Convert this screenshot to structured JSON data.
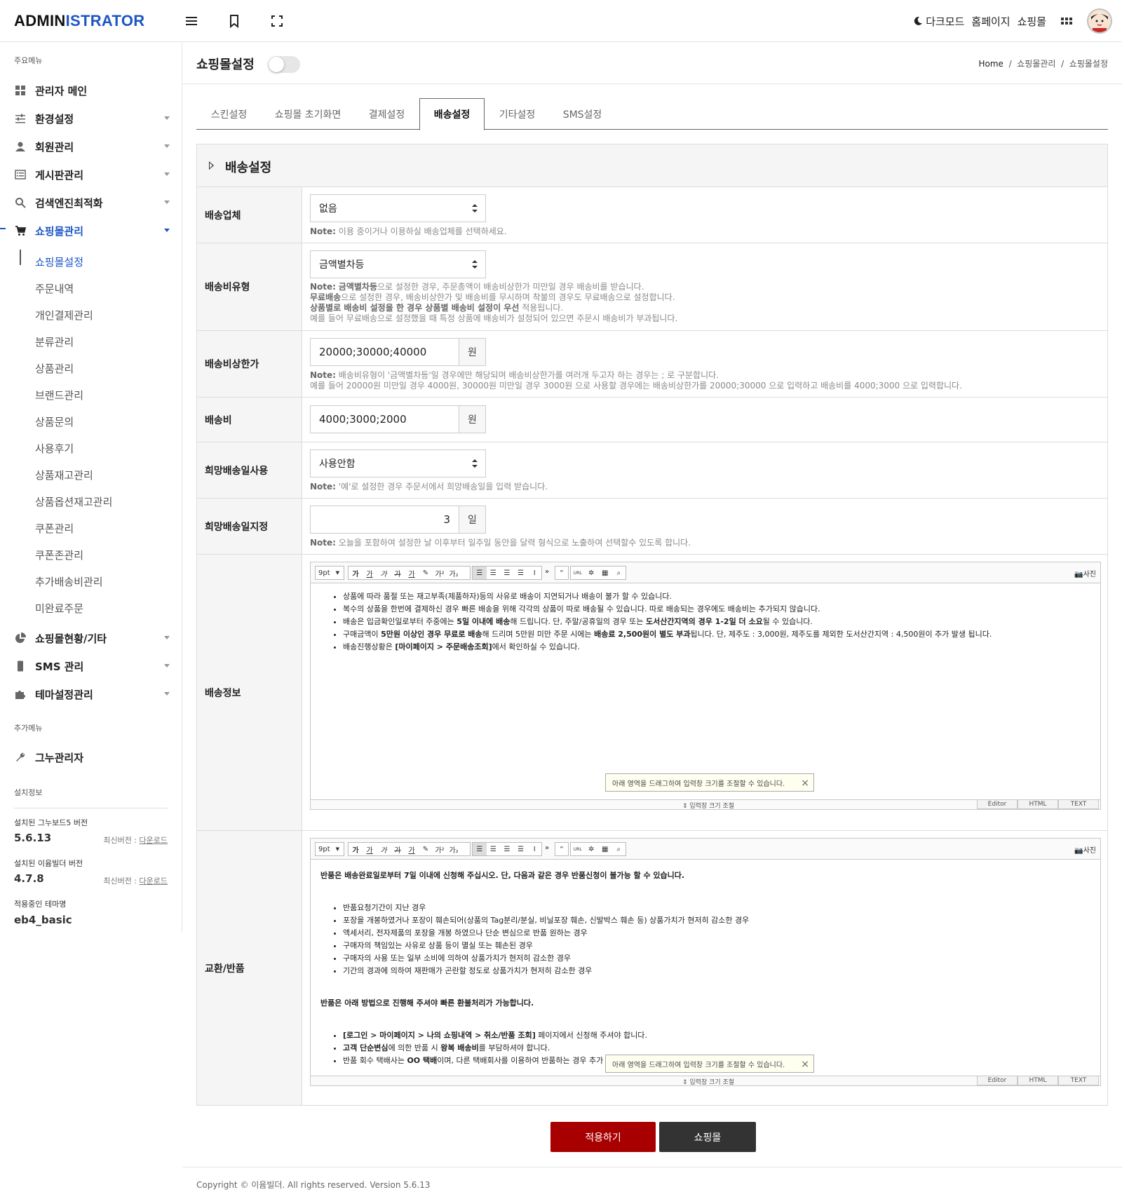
{
  "header": {
    "logo_a": "ADMIN",
    "logo_b": "ISTRATOR",
    "darkmode": "다크모드",
    "homepage": "홈페이지",
    "shop": "쇼핑몰"
  },
  "sidebar": {
    "main_label": "주요메뉴",
    "items": [
      {
        "label": "관리자 메인"
      },
      {
        "label": "환경설정"
      },
      {
        "label": "회원관리"
      },
      {
        "label": "게시판관리"
      },
      {
        "label": "검색엔진최적화"
      },
      {
        "label": "쇼핑몰관리"
      },
      {
        "label": "쇼핑몰현황/기타"
      },
      {
        "label": "SMS 관리"
      },
      {
        "label": "테마설정관리"
      }
    ],
    "submenu": [
      "쇼핑몰설정",
      "주문내역",
      "개인결제관리",
      "분류관리",
      "상품관리",
      "브랜드관리",
      "상품문의",
      "사용후기",
      "상품재고관리",
      "상품옵션재고관리",
      "쿠폰관리",
      "쿠폰존관리",
      "추가배송비관리",
      "미완료주문"
    ],
    "extra_label": "추가메뉴",
    "extra_item": "그누관리자",
    "install_label": "설치정보",
    "gnuboard_title": "설치된 그누보드5 버전",
    "gnuboard_version": "5.6.13",
    "eyoom_title": "설치된 이윰빌더 버전",
    "eyoom_version": "4.7.8",
    "latest_label": "최신버전 : ",
    "download": "다운로드",
    "theme_title": "적용중인 테마명",
    "theme_name": "eb4_basic"
  },
  "page": {
    "title": "쇼핑몰설정",
    "breadcrumb": [
      "Home",
      "쇼핑몰관리",
      "쇼핑몰설정"
    ],
    "sep": "/"
  },
  "tabs": [
    "스킨설정",
    "쇼핑몰 초기화면",
    "결제설정",
    "배송설정",
    "기타설정",
    "SMS설정"
  ],
  "section": {
    "title": "배송설정",
    "note_prefix": "Note:",
    "rows": {
      "company": {
        "label": "배송업체",
        "value": "없음",
        "note": " 이용 중이거나 이용하실 배송업체를 선택하세요."
      },
      "fee_type": {
        "label": "배송비유형",
        "value": "금액별차등",
        "n1_b": "금액별차등",
        "n1": "으로 설정한 경우, 주문총액이 배송비상한가 미만일 경우 배송비를 받습니다.",
        "n2_b": "무료배송",
        "n2": "으로 설정한 경우, 배송비상한가 및 배송비를 무시하며 착불의 경우도 무료배송으로 설정합니다.",
        "n3_b": "상품별로 배송비 설정을 한 경우 상품별 배송비 설정이 우선",
        "n3": " 적용됩니다.",
        "n4": "예를 들어 무료배송으로 설정했을 때 특정 상품에 배송비가 설정되어 있으면 주문시 배송비가 부과됩니다."
      },
      "fee_limit": {
        "label": "배송비상한가",
        "value": "20000;30000;40000",
        "unit": "원",
        "n1": " 배송비유형이 '금액별차등'일 경우에만 해당되며 배송비상한가를 여러개 두고자 하는 경우는 ; 로 구분합니다.",
        "n2": "예를 들어 20000원 미만일 경우 4000원, 30000원 미만일 경우 3000원 으로 사용할 경우에는 배송비상한가를 20000;30000 으로 입력하고 배송비를 4000;3000 으로 입력합니다."
      },
      "fee": {
        "label": "배송비",
        "value": "4000;3000;2000",
        "unit": "원"
      },
      "hope_use": {
        "label": "희망배송일사용",
        "value": "사용안함",
        "note": " '예'로 설정한 경우 주문서에서 희망배송일을 입력 받습니다."
      },
      "hope_days": {
        "label": "희망배송일지정",
        "value": "3",
        "unit": "일",
        "note": " 오늘을 포함하여 설정한 날 이후부터 일주일 동안을 달력 형식으로 노출하여 선택할수 있도록 합니다."
      },
      "delivery_info": {
        "label": "배송정보"
      },
      "exchange": {
        "label": "교환/반품"
      }
    }
  },
  "editor": {
    "font_size": "9pt",
    "photo": "사진",
    "resize": "입력창 크기 조절",
    "tip": "아래 영역을 드래그하여 입력창 크기를 조절할 수 있습니다.",
    "close": "×",
    "modes": [
      "Editor",
      "HTML",
      "TEXT"
    ],
    "tools": [
      "가",
      "가",
      "가",
      "가",
      "가",
      "가",
      "가²",
      "가₂"
    ]
  },
  "delivery_info": {
    "l1": "상품에 따라 품절 또는 재고부족(제품하자)등의 사유로 배송이 지연되거나 배송이 불가 할 수 있습니다.",
    "l2": "복수의 상품을 한번에 결제하신 경우 빠른 배송을 위해 각각의 상품이 따로 배송될 수 있습니다. 따로 배송되는 경우에도 배송비는 추가되지 않습니다.",
    "l3a": "배송은 입금확인일로부터 주중에는 ",
    "l3b": "5일 이내에 배송",
    "l3c": "해 드립니다. 단, 주말/공휴일의 경우 또는 ",
    "l3d": "도서산간지역의 경우 1-2일 더 소요",
    "l3e": "될 수 있습니다.",
    "l4a": "구매금액이 ",
    "l4b": "5만원 이상인 경우 무료로 배송",
    "l4c": "해 드리며 5만원 미만 주문 시에는 ",
    "l4d": "배송료 2,500원이 별도 부과",
    "l4e": "됩니다. 단, 제주도 : 3,000원, 제주도를 제외한 도서산간지역 : 4,500원이 추가 발생 됩니다.",
    "l5a": "배송진행상황은 ",
    "l5b": "[마이페이지 > 주문배송조회]",
    "l5c": "에서 확인하실 수 있습니다."
  },
  "exchange_info": {
    "p1": "반품은 배송완료일로부터 7일 이내에 신청해 주십시오. 단, 다음과 같은 경우 반품신청이 불가능 할 수 있습니다.",
    "list1": [
      "반품요청기간이 지난 경우",
      "포장을 개봉하였거나 포장이 훼손되어(상품의 Tag분리/분실, 비닐포장 훼손, 신발박스 훼손 등) 상품가치가 현저히 감소한 경우",
      "액세서리, 전자제품의 포장을 개봉 하였으나 단순 변심으로 반품 원하는 경우",
      "구매자의 책임있는 사유로 상품 등이 멸실 또는 훼손된 경우",
      "구매자의 사용 또는 일부 소비에 의하여 상품가치가 현저히 감소한 경우",
      "기간의 경과에 의하여 재판매가 곤란할 정도로 상품가치가 현저히 감소한 경우"
    ],
    "p2": "반품은 아래 방법으로 진행해 주셔야 빠른 환불처리가 가능합니다.",
    "b1a": "[로그인 > 마이페이지 > 나의 쇼핑내역 > 취소/반품 조회]",
    "b1b": " 페이지에서 신청해 주셔야 합니다.",
    "b2a": "고객 단순변심",
    "b2b": "에 의한 반품 시 ",
    "b2c": "왕복 배송비",
    "b2d": "를 부담하셔야 합니다.",
    "b3a": "반품 회수 택배사는 ",
    "b3b": "OO 택배",
    "b3c": "이며, 다른 택배회사를 이용하여 반품하는 경우 추가 배송비가 발생할 수 있습니다."
  },
  "buttons": {
    "apply": "적용하기",
    "shop": "쇼핑몰"
  },
  "footer": "Copyright © 이윰빌더. All rights reserved. Version 5.6.13",
  "colors": {
    "accent": "#1d56c4",
    "apply": "#a80000",
    "dark": "#333333"
  }
}
